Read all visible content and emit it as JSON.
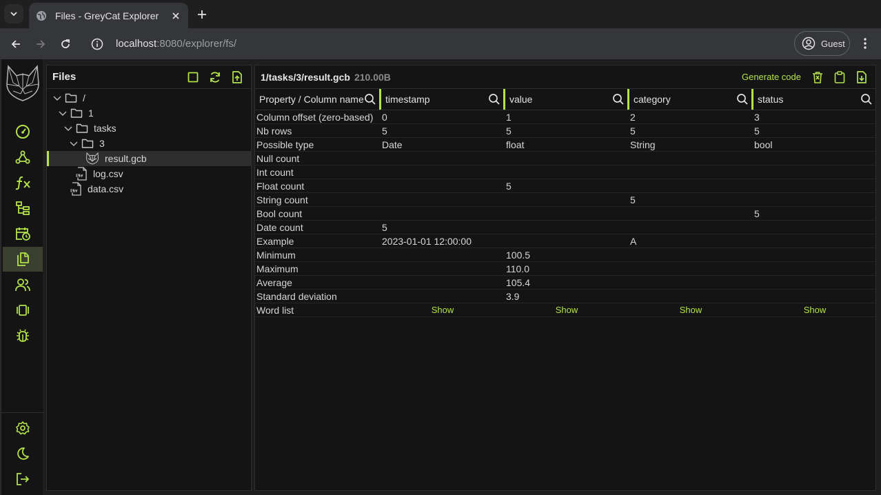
{
  "browser": {
    "tab_title": "Files - GreyCat Explorer",
    "url_host": "localhost",
    "url_rest": ":8080/explorer/fs/",
    "profile_label": "Guest"
  },
  "rail": {
    "items": [
      "dashboard-icon",
      "graph-icon",
      "function-icon",
      "tree-icon",
      "calendar-icon",
      "files-icon",
      "users-icon",
      "panels-icon",
      "bug-icon"
    ],
    "bottom": [
      "settings-icon",
      "moon-icon",
      "logout-icon"
    ]
  },
  "files": {
    "title": "Files",
    "tree": [
      {
        "label": "/",
        "type": "folder",
        "depth": 0,
        "expanded": true
      },
      {
        "label": "1",
        "type": "folder",
        "depth": 1,
        "expanded": true
      },
      {
        "label": "tasks",
        "type": "folder",
        "depth": 2,
        "expanded": true
      },
      {
        "label": "3",
        "type": "folder",
        "depth": 3,
        "expanded": true
      },
      {
        "label": "result.gcb",
        "type": "gcb",
        "depth": 4,
        "selected": true
      },
      {
        "label": "log.csv",
        "type": "csv",
        "depth": 3
      },
      {
        "label": "data.csv",
        "type": "csv",
        "depth": 2
      }
    ]
  },
  "main": {
    "path": "1/tasks/3/result.gcb",
    "size": "210.00B",
    "generate_code": "Generate code",
    "columns": [
      "Property / Column name",
      "timestamp",
      "value",
      "category",
      "status"
    ],
    "rows": [
      [
        "Column offset (zero-based)",
        "0",
        "1",
        "2",
        "3"
      ],
      [
        "Nb rows",
        "5",
        "5",
        "5",
        "5"
      ],
      [
        "Possible type",
        "Date",
        "float",
        "String",
        "bool"
      ],
      [
        "Null count",
        "",
        "",
        "",
        ""
      ],
      [
        "Int count",
        "",
        "",
        "",
        ""
      ],
      [
        "Float count",
        "",
        "5",
        "",
        ""
      ],
      [
        "String count",
        "",
        "",
        "5",
        ""
      ],
      [
        "Bool count",
        "",
        "",
        "",
        "5"
      ],
      [
        "Date count",
        "5",
        "",
        "",
        ""
      ],
      [
        "Example",
        "2023-01-01 12:00:00",
        "",
        "A",
        ""
      ],
      [
        "Minimum",
        "",
        "100.5",
        "",
        ""
      ],
      [
        "Maximum",
        "",
        "110.0",
        "",
        ""
      ],
      [
        "Average",
        "",
        "105.4",
        "",
        ""
      ],
      [
        "Standard deviation",
        "",
        "3.9",
        "",
        ""
      ]
    ],
    "word_list_label": "Word list",
    "show_label": "Show"
  },
  "colors": {
    "accent": "#b4e34a"
  }
}
